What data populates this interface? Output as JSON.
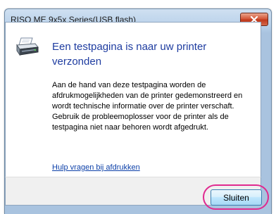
{
  "window": {
    "title": "RISO ME 9x5x Series(USB flash)"
  },
  "dialog": {
    "heading": "Een testpagina is naar uw printer verzonden",
    "description": "Aan de hand van deze testpagina worden de afdrukmogelijkheden van de printer gedemonstreerd en wordt technische informatie over de printer verschaft. Gebruik de probleemoplosser voor de printer als de testpagina niet naar behoren wordt afgedrukt.",
    "help_link": "Hulp vragen bij afdrukken",
    "close_button": "Sluiten",
    "icon": "printer-icon"
  },
  "colors": {
    "heading": "#1e3ca0",
    "link": "#0b3fa8",
    "highlight": "#e0298f",
    "close_titlebar": "#c0391c"
  }
}
